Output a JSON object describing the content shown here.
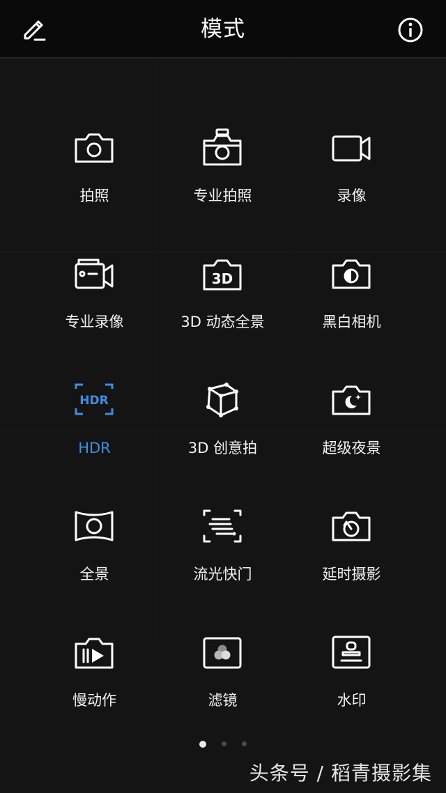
{
  "header": {
    "title": "模式",
    "edit_icon": "pencil-icon",
    "info_icon": "info-icon"
  },
  "modes": [
    {
      "label": "拍照",
      "icon": "camera-icon"
    },
    {
      "label": "专业拍照",
      "icon": "pro-camera-icon"
    },
    {
      "label": "录像",
      "icon": "video-camera-icon"
    },
    {
      "label": "专业录像",
      "icon": "pro-video-icon"
    },
    {
      "label": "3D 动态全景",
      "icon": "3d-panorama-icon",
      "icon_text": "3D"
    },
    {
      "label": "黑白相机",
      "icon": "monochrome-camera-icon"
    },
    {
      "label": "HDR",
      "icon": "hdr-icon",
      "icon_text": "HDR",
      "active": true
    },
    {
      "label": "3D 创意拍",
      "icon": "3d-cube-icon"
    },
    {
      "label": "超级夜景",
      "icon": "night-mode-icon"
    },
    {
      "label": "全景",
      "icon": "panorama-icon"
    },
    {
      "label": "流光快门",
      "icon": "light-painting-icon"
    },
    {
      "label": "延时摄影",
      "icon": "timelapse-icon"
    },
    {
      "label": "慢动作",
      "icon": "slow-motion-icon"
    },
    {
      "label": "滤镜",
      "icon": "filter-icon"
    },
    {
      "label": "水印",
      "icon": "watermark-stamp-icon"
    }
  ],
  "pagination": {
    "total": 3,
    "current": 1
  },
  "watermark": "头条号 / 稻青摄影集",
  "colors": {
    "background": "#141414",
    "header": "#0a0a0a",
    "active": "#3d8fe0",
    "text": "#f2f2f2"
  }
}
